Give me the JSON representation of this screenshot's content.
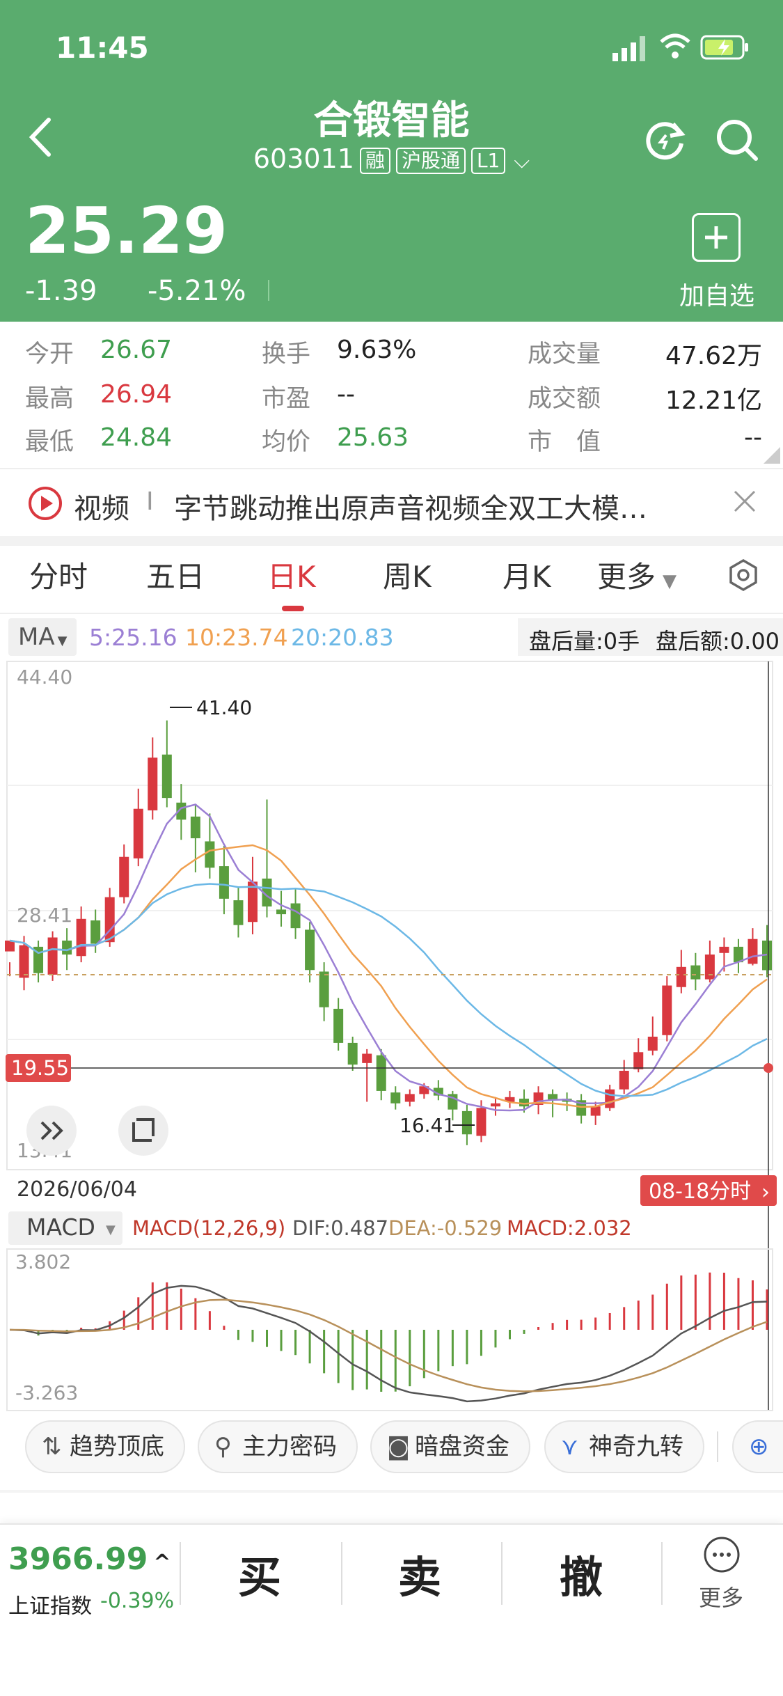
{
  "status_bar": {
    "time": "11:45"
  },
  "stock": {
    "name": "合锻智能",
    "code": "603011",
    "tags": [
      "融",
      "沪股通",
      "L1"
    ],
    "price": "25.29",
    "change": "-1.39",
    "change_pct": "-5.21%",
    "add_watch_label": "加自选"
  },
  "stats": [
    {
      "label": "今开",
      "value": "26.67",
      "color": "green"
    },
    {
      "label": "换手",
      "value": "9.63%",
      "color": "dark"
    },
    {
      "label": "成交量",
      "value": "47.62万",
      "color": "dark"
    },
    {
      "label": "最高",
      "value": "26.94",
      "color": "red"
    },
    {
      "label": "市盈",
      "value": "--",
      "color": "dark"
    },
    {
      "label": "成交额",
      "value": "12.21亿",
      "color": "dark"
    },
    {
      "label": "最低",
      "value": "24.84",
      "color": "green"
    },
    {
      "label": "均价",
      "value": "25.63",
      "color": "green"
    },
    {
      "label": "市　值",
      "value": "--",
      "color": "dark"
    }
  ],
  "news": {
    "category": "视频",
    "divider": "I",
    "text": "字节跳动推出原声音视频全双工大模…"
  },
  "tabs": [
    "分时",
    "五日",
    "日K",
    "周K",
    "月K",
    "更多"
  ],
  "active_tab": "日K",
  "ma_bar": {
    "selector": "MA",
    "ma5": "5:25.16",
    "ma10": "10:23.74",
    "ma20": "20:20.83",
    "after_volume": "盘后量:0手",
    "after_amount": "盘后额:0.00"
  },
  "colors": {
    "header": "#5aac6e",
    "up": "#d9383f",
    "down": "#5a9e3e",
    "ma5": "#9b7fd4",
    "ma10": "#f0a050",
    "ma20": "#6cb8e6"
  },
  "chart_data": {
    "type": "candlestick",
    "y_axis_labels": [
      "44.40",
      "28.41",
      "13.41"
    ],
    "ylim": [
      13.41,
      44.4
    ],
    "high_label": "41.40",
    "low_label": "16.41",
    "crosshair_value": "19.55",
    "date_label": "2026/06/04",
    "tooltip_label": "08-18分时",
    "candles": [
      [
        26.5,
        27.2,
        25.8,
        24.9
      ],
      [
        24.8,
        26.9,
        27.5,
        24.0
      ],
      [
        26.8,
        25.1,
        27.2,
        24.5
      ],
      [
        25.0,
        27.4,
        27.8,
        24.6
      ],
      [
        27.2,
        26.3,
        28.0,
        25.3
      ],
      [
        26.2,
        28.6,
        29.4,
        25.8
      ],
      [
        28.5,
        27.0,
        29.2,
        26.4
      ],
      [
        27.1,
        30.0,
        30.6,
        26.8
      ],
      [
        30.0,
        32.6,
        33.4,
        29.6
      ],
      [
        32.5,
        35.7,
        37.0,
        32.0
      ],
      [
        35.6,
        39.0,
        40.3,
        35.0
      ],
      [
        39.2,
        36.4,
        41.4,
        35.8
      ],
      [
        36.1,
        35.0,
        37.3,
        33.7
      ],
      [
        35.2,
        33.8,
        36.0,
        31.6
      ],
      [
        33.6,
        31.9,
        35.4,
        31.2
      ],
      [
        32.0,
        29.9,
        33.3,
        28.9
      ],
      [
        29.8,
        28.2,
        30.7,
        27.4
      ],
      [
        28.4,
        31.0,
        32.6,
        27.6
      ],
      [
        31.2,
        29.4,
        36.3,
        28.7
      ],
      [
        29.2,
        28.9,
        30.4,
        28.1
      ],
      [
        29.6,
        28.0,
        30.5,
        27.3
      ],
      [
        27.9,
        25.3,
        28.4,
        24.5
      ],
      [
        25.2,
        22.9,
        25.8,
        22.0
      ],
      [
        22.8,
        20.6,
        23.5,
        20.1
      ],
      [
        20.6,
        19.2,
        21.0,
        18.8
      ],
      [
        19.3,
        19.9,
        20.2,
        16.8
      ],
      [
        19.8,
        17.5,
        20.2,
        16.9
      ],
      [
        17.4,
        16.7,
        17.8,
        16.3
      ],
      [
        16.8,
        17.3,
        17.6,
        16.5
      ],
      [
        17.3,
        17.8,
        18.0,
        17.0
      ],
      [
        17.7,
        17.2,
        18.2,
        16.9
      ],
      [
        17.3,
        16.3,
        17.5,
        15.6
      ],
      [
        16.2,
        14.7,
        16.6,
        14.0
      ],
      [
        14.6,
        16.4,
        16.9,
        14.2
      ],
      [
        16.5,
        16.7,
        17.1,
        15.9
      ],
      [
        16.8,
        17.1,
        17.5,
        16.4
      ],
      [
        17.0,
        16.5,
        17.6,
        16.1
      ],
      [
        16.6,
        17.4,
        17.8,
        16.0
      ],
      [
        17.3,
        16.9,
        17.6,
        15.8
      ],
      [
        17.0,
        16.8,
        17.4,
        16.2
      ],
      [
        16.9,
        15.9,
        17.3,
        15.4
      ],
      [
        15.9,
        16.5,
        16.8,
        15.3
      ],
      [
        16.4,
        17.6,
        17.9,
        16.2
      ],
      [
        17.6,
        18.8,
        19.5,
        17.3
      ],
      [
        18.9,
        20.0,
        20.9,
        18.7
      ],
      [
        20.1,
        21.0,
        22.3,
        19.8
      ],
      [
        21.1,
        24.3,
        24.9,
        20.7
      ],
      [
        24.2,
        25.5,
        26.6,
        23.8
      ],
      [
        25.6,
        24.7,
        26.4,
        24.0
      ],
      [
        24.7,
        26.3,
        27.2,
        24.5
      ],
      [
        26.4,
        26.8,
        27.4,
        25.2
      ],
      [
        26.8,
        25.8,
        27.3,
        25.1
      ],
      [
        25.7,
        27.3,
        28.0,
        25.6
      ],
      [
        27.2,
        25.29,
        28.2,
        24.84
      ]
    ],
    "ma_visible": true
  },
  "macd": {
    "selector": "MACD",
    "params": "MACD(12,26,9)",
    "dif": "DIF:0.487",
    "dea": "DEA:-0.529",
    "macd": "MACD:2.032",
    "ymax_label": "3.802",
    "ymin_label": "-3.263",
    "ylim": [
      -3.263,
      3.802
    ]
  },
  "tools": [
    {
      "icon": "⇅",
      "label": "趋势顶底"
    },
    {
      "icon": "⚲",
      "label": "主力密码"
    },
    {
      "icon": "◙",
      "label": "暗盘资金"
    },
    {
      "icon": "⋎",
      "label": "神奇九转"
    }
  ],
  "bottom": {
    "index_value": "3966.99",
    "index_name": "上证指数",
    "index_change": "-0.39%",
    "buy": "买",
    "sell": "卖",
    "cancel": "撤",
    "more": "更多"
  }
}
